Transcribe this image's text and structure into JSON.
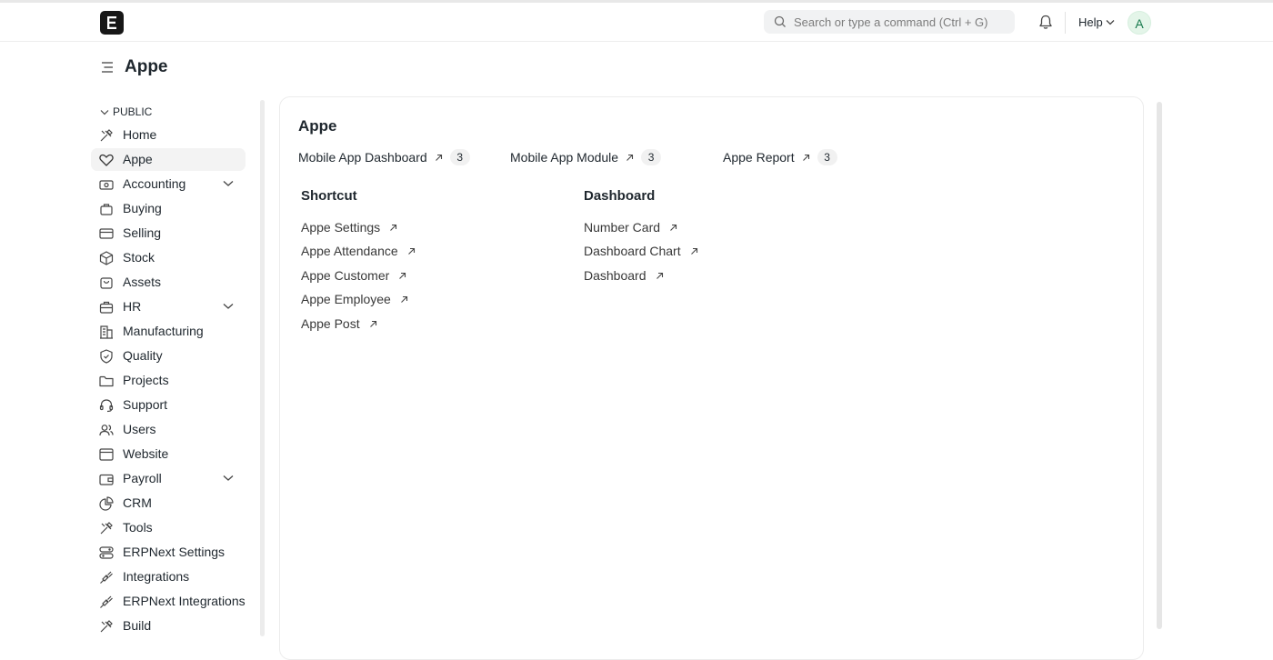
{
  "navbar": {
    "search_placeholder": "Search or type a command (Ctrl + G)",
    "help_label": "Help",
    "avatar_letter": "A"
  },
  "page": {
    "title": "Appe"
  },
  "sidebar": {
    "section_label": "PUBLIC",
    "items": [
      {
        "label": "Home",
        "icon": "home-tools-icon"
      },
      {
        "label": "Appe",
        "icon": "heart-icon",
        "active": true
      },
      {
        "label": "Accounting",
        "icon": "money-icon",
        "expandable": true
      },
      {
        "label": "Buying",
        "icon": "bag-icon"
      },
      {
        "label": "Selling",
        "icon": "card-icon"
      },
      {
        "label": "Stock",
        "icon": "box-icon"
      },
      {
        "label": "Assets",
        "icon": "shopping-bag-icon"
      },
      {
        "label": "HR",
        "icon": "briefcase-icon",
        "expandable": true
      },
      {
        "label": "Manufacturing",
        "icon": "building-icon"
      },
      {
        "label": "Quality",
        "icon": "shield-check-icon"
      },
      {
        "label": "Projects",
        "icon": "folder-icon"
      },
      {
        "label": "Support",
        "icon": "headset-icon"
      },
      {
        "label": "Users",
        "icon": "users-icon"
      },
      {
        "label": "Website",
        "icon": "browser-icon"
      },
      {
        "label": "Payroll",
        "icon": "wallet-icon",
        "expandable": true
      },
      {
        "label": "CRM",
        "icon": "pie-chart-icon"
      },
      {
        "label": "Tools",
        "icon": "tools-icon"
      },
      {
        "label": "ERPNext Settings",
        "icon": "settings-toggle-icon"
      },
      {
        "label": "Integrations",
        "icon": "plug-icon"
      },
      {
        "label": "ERPNext Integrations",
        "icon": "plug-icon"
      },
      {
        "label": "Build",
        "icon": "tools-icon"
      }
    ]
  },
  "card": {
    "title": "Appe",
    "quick_links": [
      {
        "label": "Mobile App Dashboard",
        "count": "3"
      },
      {
        "label": "Mobile App Module",
        "count": "3"
      },
      {
        "label": "Appe Report",
        "count": "3"
      }
    ],
    "groups": [
      {
        "title": "Shortcut",
        "links": [
          "Appe Settings",
          "Appe Attendance",
          "Appe Customer",
          "Appe Employee",
          "Appe Post"
        ]
      },
      {
        "title": "Dashboard",
        "links": [
          "Number Card",
          "Dashboard Chart",
          "Dashboard"
        ]
      }
    ]
  }
}
